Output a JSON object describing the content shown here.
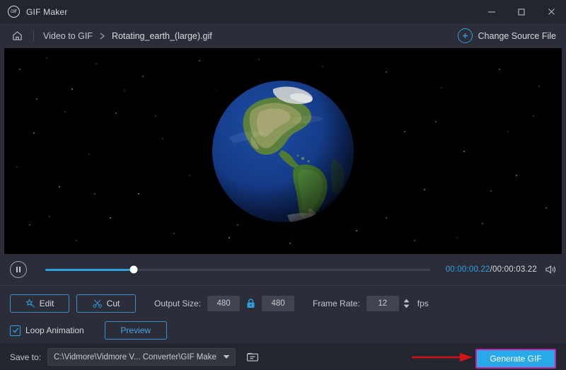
{
  "window": {
    "title": "GIF Maker",
    "app_icon": "gif-circle-icon",
    "minimize": "—",
    "maximize": "□",
    "close": "×"
  },
  "breadcrumb": {
    "home_icon": "home-icon",
    "parent": "Video to GIF",
    "separator": "›",
    "current": "Rotating_earth_(large).gif"
  },
  "header_action": {
    "icon": "plus-circle-icon",
    "label": "Change Source File"
  },
  "preview": {
    "content": "Rotating earth animation over starfield",
    "background": "#000000"
  },
  "player": {
    "pause_icon": "pause-icon",
    "progress_percent": 23,
    "current_time": "00:00:00.22",
    "time_separator": "/",
    "total_time": "00:00:03.22",
    "volume_icon": "speaker-icon"
  },
  "options": {
    "edit_button": {
      "label": "Edit",
      "icon": "magic-wand-icon"
    },
    "cut_button": {
      "label": "Cut",
      "icon": "scissors-icon"
    },
    "output_size_label": "Output Size:",
    "output_width": "480",
    "output_height": "480",
    "lock_icon": "lock-closed-icon",
    "frame_rate_label": "Frame Rate:",
    "frame_rate": "12",
    "frame_rate_units": "fps",
    "loop_animation_label": "Loop Animation",
    "loop_animation_checked": true,
    "preview_button": "Preview"
  },
  "save": {
    "label": "Save to:",
    "path": "C:\\Vidmore\\Vidmore V... Converter\\GIF Maker",
    "dropdown_icon": "chevron-down-icon",
    "folder_icon": "folder-icon",
    "generate_button": "Generate GIF"
  },
  "colors": {
    "accent_blue": "#2f9fe0",
    "generate_fill": "#29a8ea",
    "generate_border": "#c026a8",
    "annotation_arrow": "#d21414",
    "titlebar_bg": "#23252f",
    "panel_bg": "#2b2d39"
  }
}
